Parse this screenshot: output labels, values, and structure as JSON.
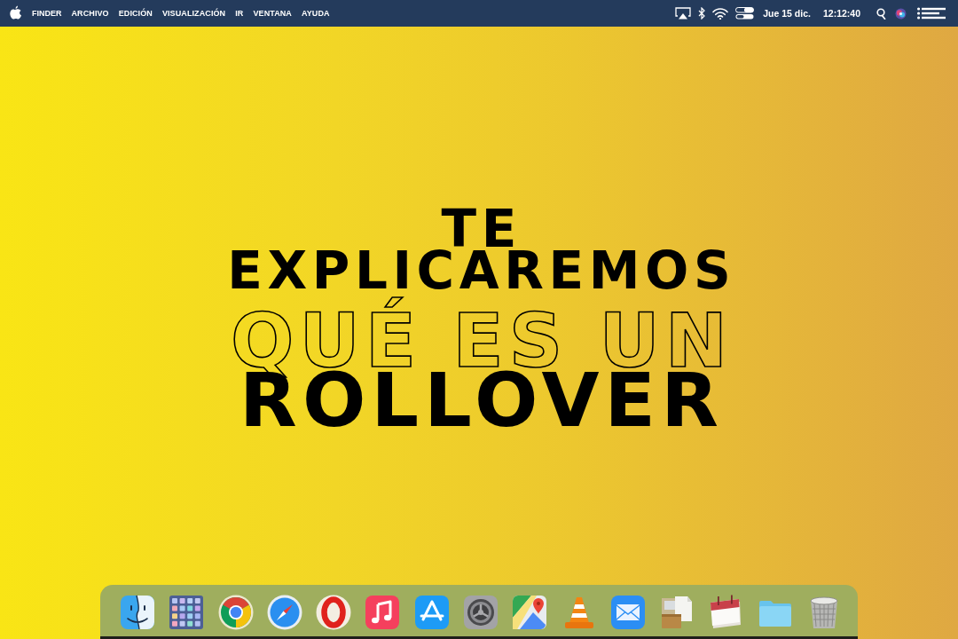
{
  "menu_bar": {
    "menus": [
      {
        "label": "FINDER",
        "kind": "app"
      },
      {
        "label": "ARCHIVO",
        "kind": "menu"
      },
      {
        "label": "EDICIÓN",
        "kind": "menu"
      },
      {
        "label": "VISUALIZACIÓN",
        "kind": "menu"
      },
      {
        "label": "IR",
        "kind": "menu"
      },
      {
        "label": "VENTANA",
        "kind": "menu"
      },
      {
        "label": "AYUDA",
        "kind": "menu"
      }
    ],
    "date": "Jue 15 dic.",
    "time": "12:12:40"
  },
  "headline": {
    "lines": [
      {
        "text": "TE",
        "kind": "lead"
      },
      {
        "text": "EXPLICAREMOS",
        "kind": "lead"
      },
      {
        "text": "QUÉ ES UN",
        "kind": "outline"
      },
      {
        "text": "ROLLOVER",
        "kind": "main"
      }
    ]
  }
}
